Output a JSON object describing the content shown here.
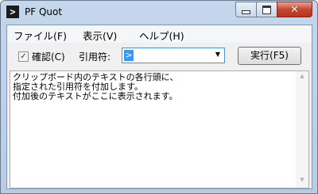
{
  "window": {
    "title": "PF Quot",
    "icon_glyph": ">",
    "minimize_glyph": "",
    "maximize_glyph": "",
    "close_glyph": "✕"
  },
  "menu": [
    "ファイル(F)",
    "表示(V)",
    "ヘルプ(H)"
  ],
  "toolbar": {
    "confirm_checked": true,
    "confirm_check_glyph": "✓",
    "confirm_label": "確認(C)",
    "quote_label": "引用符:",
    "quote_value": ">",
    "dropdown_arrow": "▼",
    "run_label": "実行(F5)"
  },
  "editor": {
    "text": "クリップボード内のテキストの各行頭に、\n指定された引用符を付加します。\n付加後のテキストがここに表示されます。",
    "scroll_up": "▲",
    "scroll_down": "▼"
  },
  "colors": {
    "selection": "#3399ff",
    "close_button": "#c7452f"
  }
}
